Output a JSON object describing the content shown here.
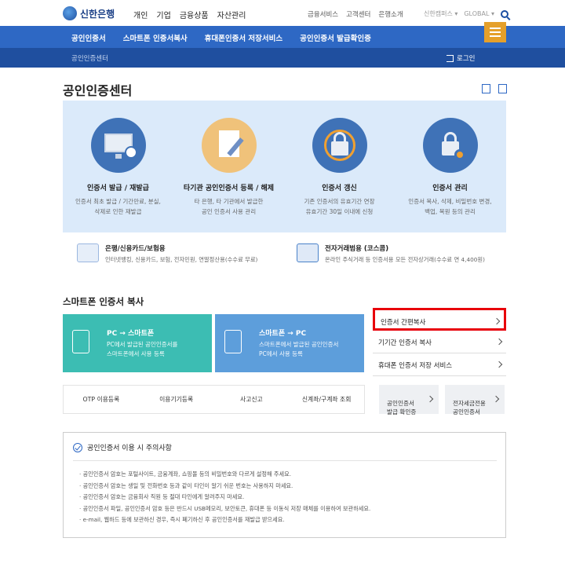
{
  "header": {
    "brand": "신한은행",
    "topnav": [
      "개인",
      "기업",
      "금융상품",
      "자산관리"
    ],
    "utilnav": [
      "금융서비스",
      "고객센터",
      "은행소개"
    ],
    "rightnav": [
      "신한캠퍼스 ▾",
      "GLOBAL ▾"
    ]
  },
  "bluenav": {
    "items": [
      "공인인증서",
      "스마트폰 인증서복사",
      "휴대폰인증서 저장서비스",
      "공인인증서 발급확인증"
    ]
  },
  "subbar": {
    "crumb": "공인인증센터",
    "login": "로그인"
  },
  "page": {
    "title": "공인인증센터"
  },
  "services": [
    {
      "title": "인증서 발급 / 재발급",
      "desc": "인증서 최초 발급 / 기간만료, 분실,\n삭제로 인한 재발급"
    },
    {
      "title": "타기관 공인인증서 등록 / 해제",
      "desc": "타 은행, 타 기관에서 발급한\n공인 인증서 사용 관리"
    },
    {
      "title": "인증서 갱신",
      "desc": "기존 인증서의 유효기간 연장\n유효기간 30일 이내에 신청"
    },
    {
      "title": "인증서 관리",
      "desc": "인증서 복사, 삭제, 비밀번호 변경,\n백업, 복원 등의 관리"
    }
  ],
  "info": [
    {
      "title": "은행/신용카드/보험용",
      "desc": "인터넷뱅킹, 신용카드, 보험, 전자민원, 연말정산용(수수료 무료)"
    },
    {
      "title": "전자거래범용 (코스콤)",
      "desc": "온라인 주식거래 등 인증서용 모든 전자상거래(수수료 연 4,400원)"
    }
  ],
  "smartphone": {
    "title": "스마트폰 인증서 복사",
    "cards": [
      {
        "title": "PC → 스마트폰",
        "desc": "PC에서 발급된 공인인증서를\n스마트폰에서 사용 등록"
      },
      {
        "title": "스마트폰 → PC",
        "desc": "스마트폰에서 발급된 공인인증서\nPC에서 사용 등록"
      }
    ],
    "links": [
      "인증서 간편복사",
      "기기간 인증서 복사",
      "휴대폰 인증서 저장 서비스"
    ],
    "tools": [
      "OTP 이용등록",
      "이용기기등록",
      "사고신고",
      "신계좌/구계좌 조회"
    ],
    "mini": [
      "공인인증서\n발급 확인증",
      "전자세금전용\n공인인증서"
    ]
  },
  "notice": {
    "title": "공인인증서 이용 시 주의사항",
    "items": [
      "· 공인인증서 암호는 포털사이트, 금융계좌, 쇼핑몰 등의 비밀번호와 다르게 설정해 주세요.",
      "· 공인인증서 암호는 생일 및 전화번호 등과 같이 타인이 알기 쉬운 번호는 사용하지 마세요.",
      "· 공인인증서 암호는 금융회사 직원 등 절대 타인에게 알려주지 마세요.",
      "· 공인인증서 파일, 공인인증서 암호 등은 반드시 USB메모리, 보안토큰, 휴대폰 등 이동식 저장 매체를 이용하여 보관하세요.",
      "· e-mail, 웹하드 등에 보관하신 경우, 즉시 폐기하신 후 공인인증서를 재발급 받으세요."
    ]
  },
  "colors": {
    "primary": "#2e68c4",
    "dark_primary": "#1f4f9f",
    "accent": "#e5a02b",
    "teal": "#3cbdb3",
    "highlight": "#e8000b"
  }
}
